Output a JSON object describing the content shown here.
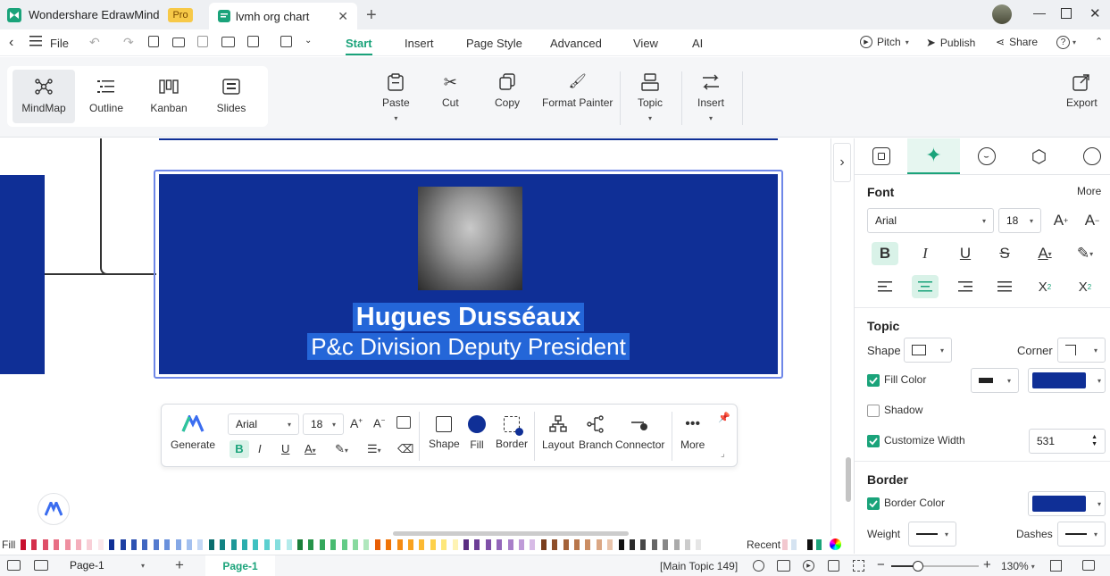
{
  "window": {
    "app_tab": "Wondershare EdrawMind",
    "pro_badge": "Pro",
    "doc_tab": "lvmh org chart"
  },
  "menubar": {
    "file_label": "File",
    "tabs": [
      "Start",
      "Insert",
      "Page Style",
      "Advanced",
      "View",
      "AI"
    ],
    "active_tab": "Start",
    "pitch_label": "Pitch",
    "publish_label": "Publish",
    "share_label": "Share"
  },
  "ribbon": {
    "views": [
      "MindMap",
      "Outline",
      "Kanban",
      "Slides"
    ],
    "active_view": "MindMap",
    "paste_label": "Paste",
    "cut_label": "Cut",
    "copy_label": "Copy",
    "format_painter_label": "Format Painter",
    "topic_label": "Topic",
    "insert_label": "Insert",
    "export_label": "Export"
  },
  "card": {
    "name": "Hugues Dusséaux",
    "title": "P&c Division Deputy President",
    "fill_color": "#0f2f96"
  },
  "floating_toolbar": {
    "generate_label": "Generate",
    "font": "Arial",
    "size": "18",
    "shape_label": "Shape",
    "fill_label": "Fill",
    "border_label": "Border",
    "layout_label": "Layout",
    "branch_label": "Branch",
    "connector_label": "Connector",
    "more_label": "More"
  },
  "panel": {
    "font_heading": "Font",
    "more_label": "More",
    "font_family": "Arial",
    "font_size": "18",
    "topic_heading": "Topic",
    "shape_label": "Shape",
    "corner_label": "Corner",
    "fill_color_label": "Fill Color",
    "shadow_label": "Shadow",
    "customize_width_label": "Customize Width",
    "width_value": "531",
    "border_heading": "Border",
    "border_color_label": "Border Color",
    "weight_label": "Weight",
    "dashes_label": "Dashes",
    "fill_checked": true,
    "shadow_checked": false,
    "width_checked": true,
    "border_checked": true
  },
  "palette": {
    "fill_label": "Fill",
    "recent_label": "Recent"
  },
  "status": {
    "page_select": "Page-1",
    "page_tab": "Page-1",
    "selection": "[Main Topic 149]",
    "zoom": "130%"
  },
  "colors": {
    "accent": "#1aa37a",
    "card_blue": "#0f2f96",
    "selection_blue": "#2466d8"
  }
}
